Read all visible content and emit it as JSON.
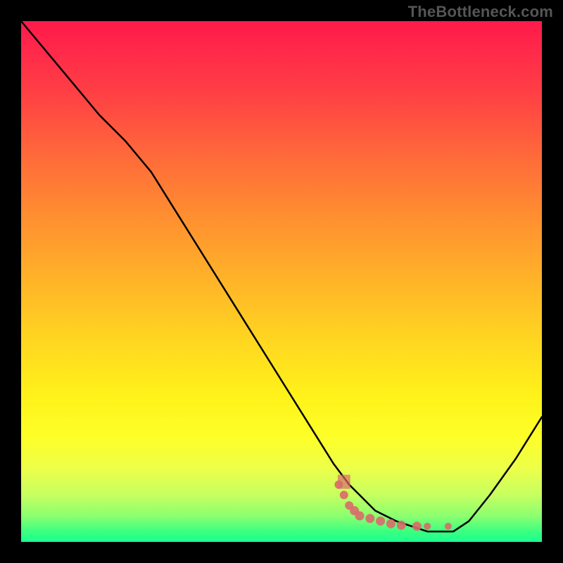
{
  "watermark": "TheBottleneck.com",
  "colors": {
    "background": "#000000",
    "curve": "#000000",
    "marker": "#d96a6a",
    "gradient_top": "#ff1a4a",
    "gradient_bottom": "#1aff90"
  },
  "chart_data": {
    "type": "line",
    "title": "",
    "xlabel": "",
    "ylabel": "",
    "xlim": [
      0,
      100
    ],
    "ylim": [
      0,
      100
    ],
    "series": [
      {
        "name": "curve",
        "x": [
          0,
          5,
          10,
          15,
          20,
          25,
          30,
          35,
          40,
          45,
          50,
          55,
          60,
          63,
          65,
          68,
          70,
          72,
          75,
          78,
          80,
          83,
          86,
          90,
          95,
          100
        ],
        "y": [
          100,
          94,
          88,
          82,
          77,
          71,
          63,
          55,
          47,
          39,
          31,
          23,
          15,
          11,
          9,
          6,
          5,
          4,
          3,
          2,
          2,
          2,
          4,
          9,
          16,
          24
        ]
      }
    ],
    "markers": {
      "name": "bottom-cluster",
      "color": "#d96a6a",
      "points": [
        {
          "x": 61,
          "y": 11
        },
        {
          "x": 62,
          "y": 9
        },
        {
          "x": 63,
          "y": 7
        },
        {
          "x": 64,
          "y": 6
        },
        {
          "x": 65,
          "y": 5
        },
        {
          "x": 67,
          "y": 4.5
        },
        {
          "x": 69,
          "y": 4
        },
        {
          "x": 71,
          "y": 3.5
        },
        {
          "x": 73,
          "y": 3.2
        },
        {
          "x": 76,
          "y": 3
        },
        {
          "x": 78,
          "y": 3
        },
        {
          "x": 82,
          "y": 3
        }
      ]
    },
    "grid": false,
    "legend": false
  }
}
